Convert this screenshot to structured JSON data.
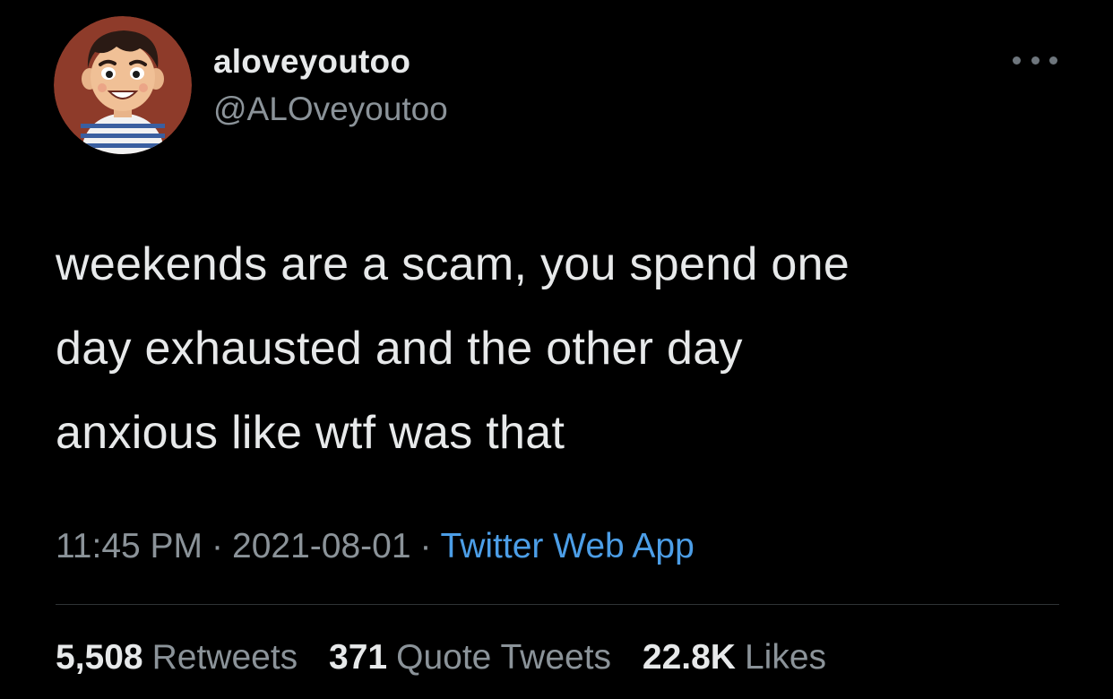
{
  "author": {
    "display_name": "aloveyoutoo",
    "handle": "@ALOveyoutoo",
    "avatar_icon": "cartoon-boy-avatar"
  },
  "tweet": {
    "text_lines": [
      "weekends are a scam, you spend one",
      "day exhausted and the other day",
      "anxious like wtf was that"
    ],
    "time": "11:45 PM",
    "date": "2021-08-01",
    "separator": "·",
    "source": "Twitter Web App"
  },
  "stats": {
    "retweets": {
      "count": "5,508",
      "label": "Retweets"
    },
    "quote_tweets": {
      "count": "371",
      "label": "Quote Tweets"
    },
    "likes": {
      "count": "22.8K",
      "label": "Likes"
    }
  },
  "icons": {
    "more": "more-horizontal-icon"
  },
  "colors": {
    "background": "#000000",
    "primary_text": "#e7e9ea",
    "secondary_text": "#8b9399",
    "link": "#4c9ee7",
    "divider": "#2f3336"
  }
}
